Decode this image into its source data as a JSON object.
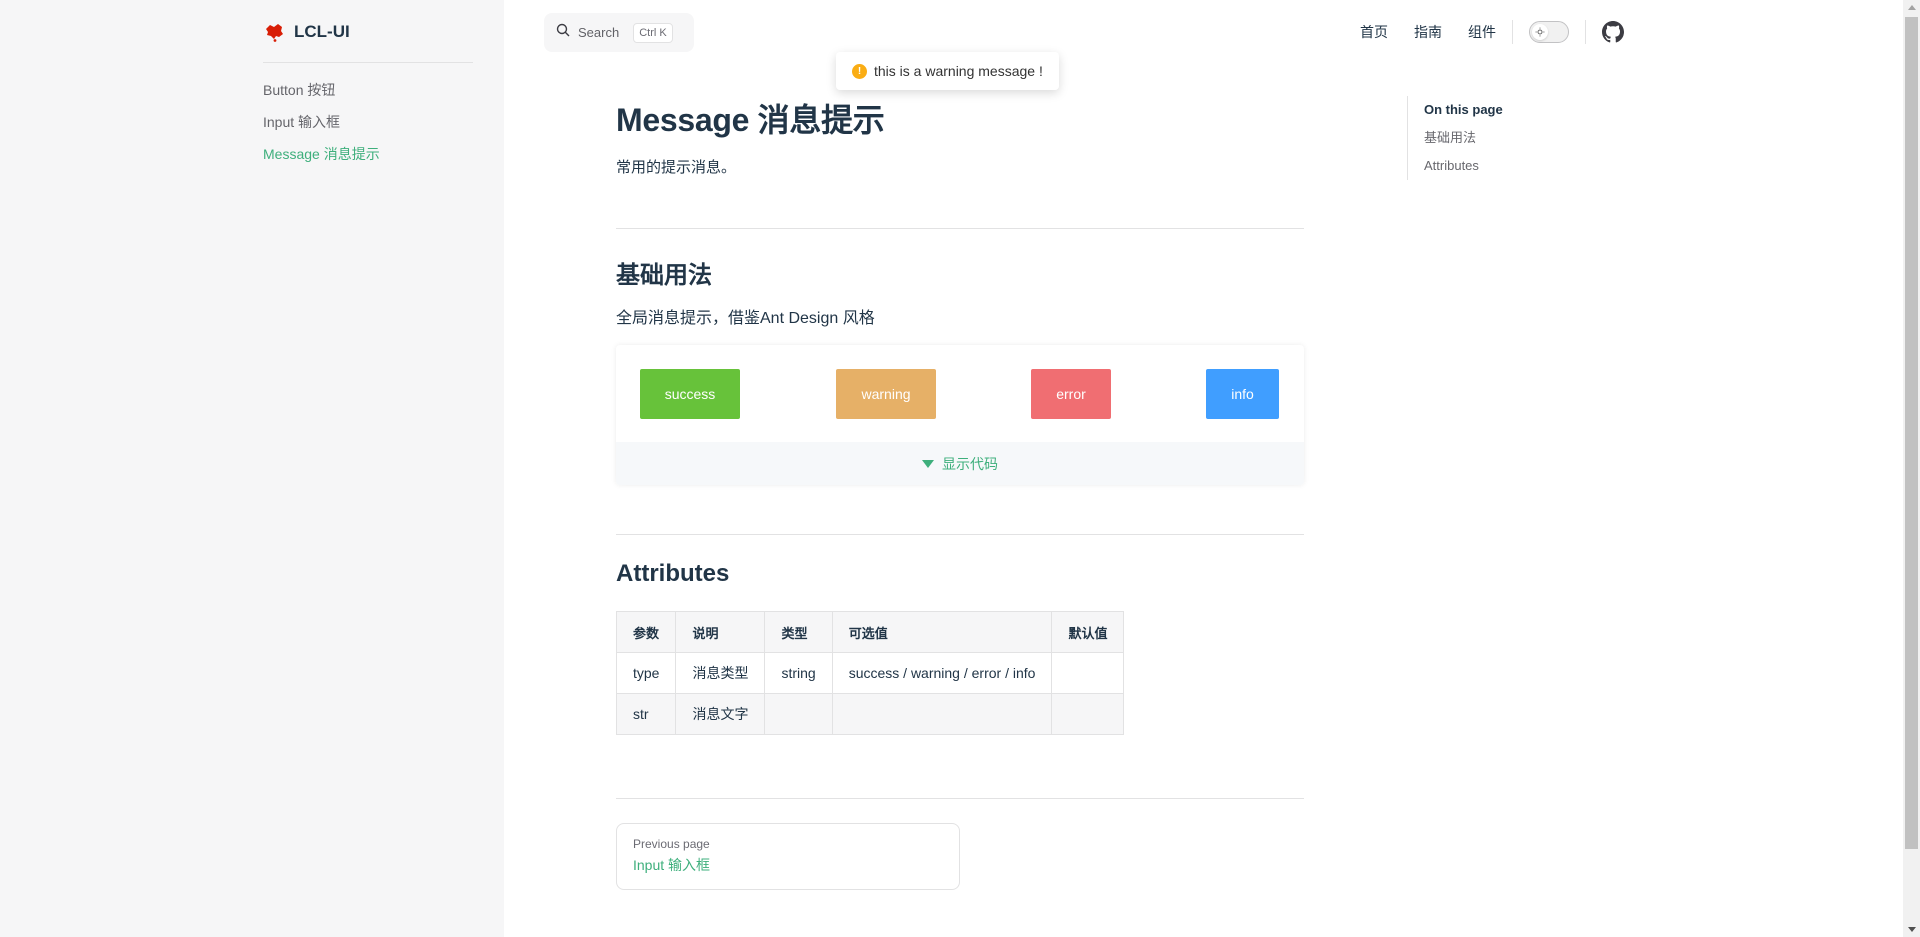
{
  "brand": {
    "title": "LCL-UI",
    "logo_color": "#d81e06"
  },
  "sidebar": {
    "items": [
      {
        "label": "Button 按钮",
        "active": false
      },
      {
        "label": "Input 输入框",
        "active": false
      },
      {
        "label": "Message 消息提示",
        "active": true
      }
    ]
  },
  "search": {
    "label": "Search",
    "shortcut_mod": "Ctrl",
    "shortcut_key": "K"
  },
  "topnav": {
    "home": "首页",
    "guide": "指南",
    "components": "组件"
  },
  "toast": {
    "text": "this is a warning message !",
    "icon": "warning-icon",
    "icon_glyph": "!",
    "icon_color": "#faad14"
  },
  "page": {
    "title": "Message 消息提示",
    "lead": "常用的提示消息。",
    "section_basic": "基础用法",
    "section_basic_desc": "全局消息提示，借鉴Ant Design 风格",
    "demo": {
      "buttons": [
        {
          "label": "success",
          "color": "#67c23a"
        },
        {
          "label": "warning",
          "color": "#e6b067"
        },
        {
          "label": "error",
          "color": "#f06e72"
        },
        {
          "label": "info",
          "color": "#409eff"
        }
      ],
      "toggle_label": "显示代码"
    },
    "section_attrs": "Attributes",
    "table": {
      "headers": [
        "参数",
        "说明",
        "类型",
        "可选值",
        "默认值"
      ],
      "rows": [
        [
          "type",
          "消息类型",
          "string",
          "success / warning / error / info",
          ""
        ],
        [
          "str",
          "消息文字",
          "",
          "",
          ""
        ]
      ]
    },
    "prev": {
      "desc": "Previous page",
      "title": "Input 输入框"
    }
  },
  "outline": {
    "title": "On this page",
    "links": [
      "基础用法",
      "Attributes"
    ]
  },
  "colors": {
    "accent": "#3eaf7c",
    "sidebar_bg": "#f6f6f7"
  }
}
